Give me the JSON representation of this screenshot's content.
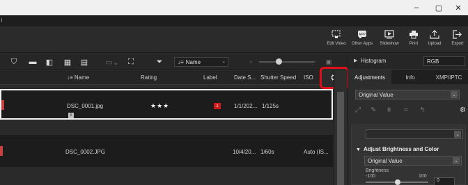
{
  "window": {
    "minimize_glyph": "–",
    "maximize_glyph": "▢",
    "close_glyph": "✕"
  },
  "toolbar": {
    "items": [
      {
        "label": "Edit Video",
        "icon": "edit-video-icon"
      },
      {
        "label": "Other Apps",
        "icon": "app-icon"
      },
      {
        "label": "Slideshow",
        "icon": "slideshow-icon"
      },
      {
        "label": "Print",
        "icon": "print-icon"
      },
      {
        "label": "Upload",
        "icon": "upload-icon"
      },
      {
        "label": "Export",
        "icon": "export-icon"
      }
    ]
  },
  "viewbar": {
    "sort_value": "Name"
  },
  "columns": {
    "name": "Name",
    "rating": "Rating",
    "label": "Label",
    "date": "Date S...",
    "shutter": "Shutter Speed",
    "iso": "ISO"
  },
  "rows": [
    {
      "name": "DSC_0001.jpg",
      "rating": "★★★",
      "label_value": "1",
      "date": "1/1/202...",
      "shutter": "1/125s",
      "iso": ""
    },
    {
      "name": "DSC_0002.JPG",
      "rating": "",
      "label_value": "",
      "date": "10/4/20...",
      "shutter": "1/60s",
      "iso": "Auto (IS..."
    }
  ],
  "right_panel": {
    "histogram_label": "Histogram",
    "channel_value": "RGB",
    "tabs": [
      "Adjustments",
      "Info",
      "XMP/IPTC"
    ],
    "preset_value": "Original Value",
    "section_title": "Adjust Brightness and Color",
    "section_preset_value": "Original Value",
    "brightness_label": "Brightness",
    "brightness_min": "-100",
    "brightness_max": "100",
    "brightness_value": "0"
  },
  "colors": {
    "highlight": "#e0101a",
    "label_red": "#d01a1a",
    "background": "#2a2a2a"
  }
}
